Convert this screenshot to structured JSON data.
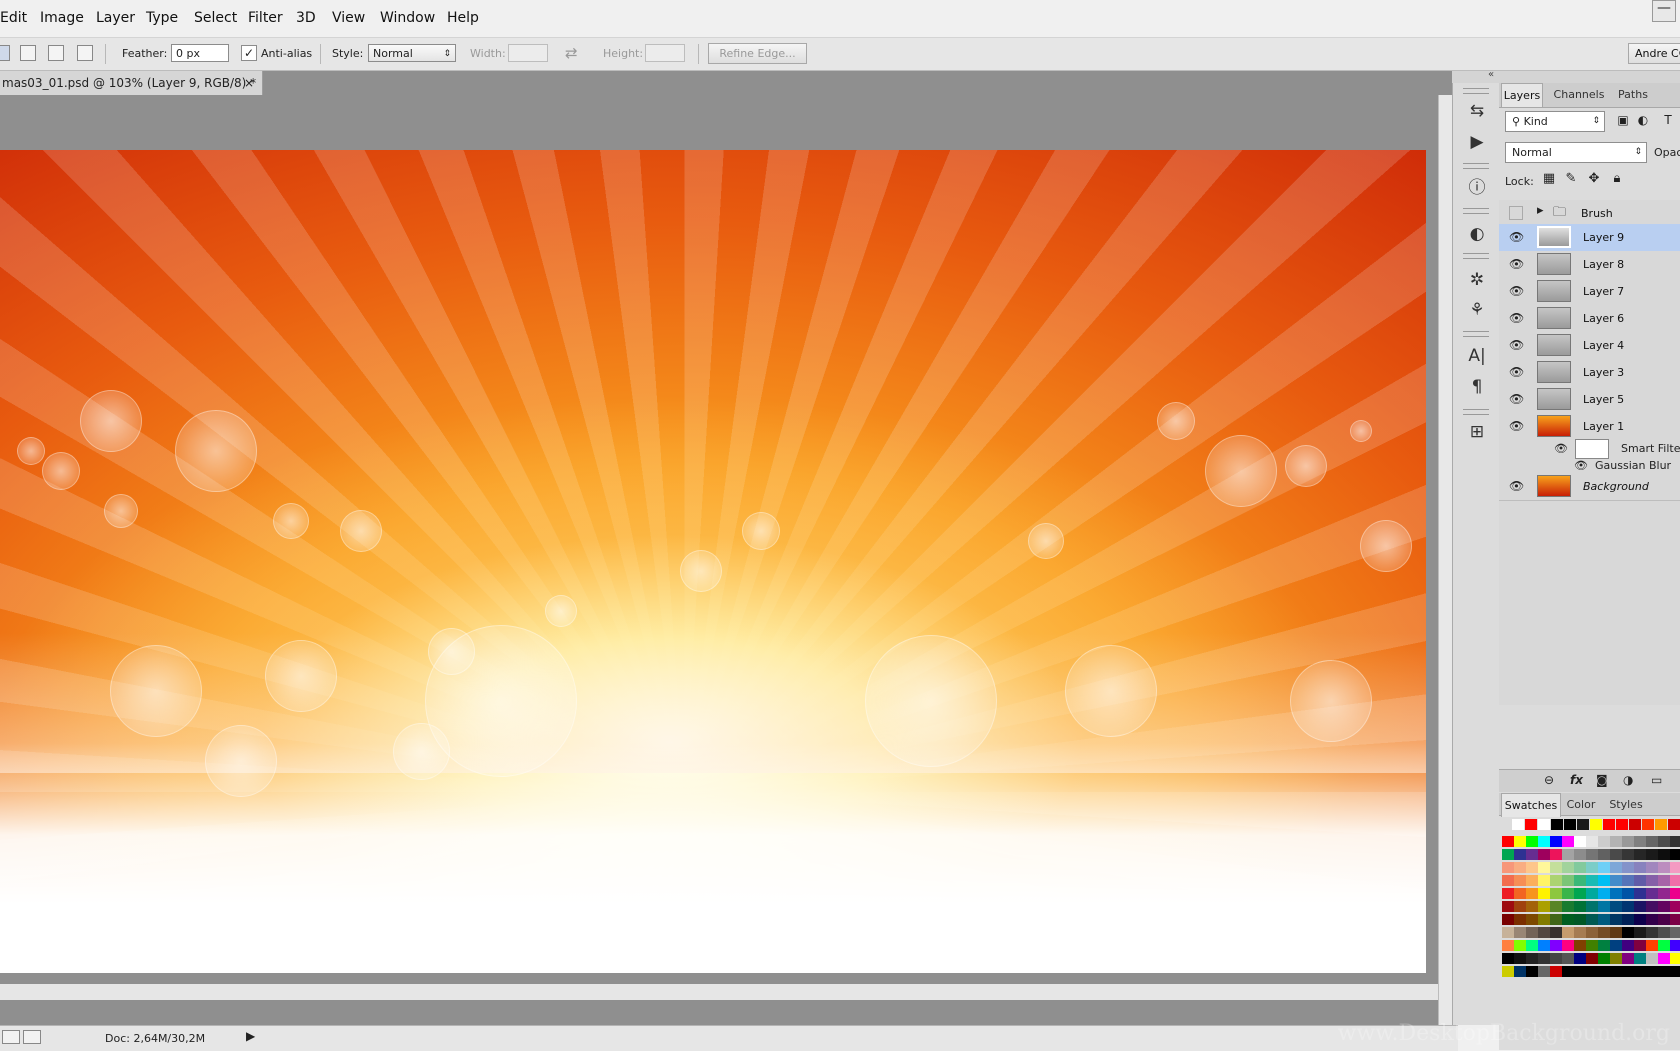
{
  "menu": [
    "Edit",
    "Image",
    "Layer",
    "Type",
    "Select",
    "Filter",
    "3D",
    "View",
    "Window",
    "Help"
  ],
  "window": {
    "minimize": "—"
  },
  "options": {
    "feather_label": "Feather:",
    "feather_value": "0 px",
    "antialias_label": "Anti-alias",
    "antialias_check": "✓",
    "style_label": "Style:",
    "style_value": "Normal",
    "width_label": "Width:",
    "height_label": "Height:",
    "swap_icon": "⇄",
    "refine_edge": "Refine Edge...",
    "user_button": "Andre CC"
  },
  "document": {
    "tab_title": "mas03_01.psd @ 103% (Layer 9, RGB/8) *",
    "close": "×"
  },
  "status": {
    "doc_size": "Doc: 2,64M/30,2M",
    "arrow": "▶"
  },
  "panel_collapse": "«",
  "tools": {
    "history": "⇆",
    "actions": "▶",
    "info": "ⓘ",
    "adjustments": "◐",
    "navigator": "✲",
    "brush": "⚘",
    "character": "A|",
    "paragraph": "¶",
    "tool_presets": "⊞"
  },
  "layers_panel": {
    "tabs": [
      "Layers",
      "Channels",
      "Paths"
    ],
    "kind": "Kind",
    "blend_mode": "Normal",
    "opacity_label": "Opac",
    "lock_label": "Lock:",
    "layers": [
      {
        "name": "Brush",
        "type": "group",
        "visible": false,
        "selected": false
      },
      {
        "name": "Layer 9",
        "visible": true,
        "selected": true
      },
      {
        "name": "Layer 8",
        "visible": true,
        "selected": false
      },
      {
        "name": "Layer 7",
        "visible": true,
        "selected": false
      },
      {
        "name": "Layer 6",
        "visible": true,
        "selected": false
      },
      {
        "name": "Layer 4",
        "visible": true,
        "selected": false
      },
      {
        "name": "Layer 3",
        "visible": true,
        "selected": false
      },
      {
        "name": "Layer 5",
        "visible": true,
        "selected": false
      },
      {
        "name": "Layer 1",
        "visible": true,
        "selected": false
      },
      {
        "name": "Background",
        "visible": true,
        "selected": false,
        "italic": true
      }
    ],
    "smart_filters": "Smart Filters",
    "gaussian_blur": "Gaussian Blur",
    "bottom_icons": {
      "link": "⊖",
      "fx": "fx",
      "mask": "◙",
      "adjust": "◑",
      "folder": "▭"
    }
  },
  "swatches_panel": {
    "tabs": [
      "Swatches",
      "Color",
      "Styles"
    ],
    "top_row": [
      "#ffffff",
      "#ff0000",
      "#ffffff",
      "#000000",
      "#000000",
      "#1a1a1a",
      "#ffff00",
      "#ff0000",
      "#ff0000",
      "#cc0000",
      "#ff3300",
      "#ff9900",
      "#cc0000"
    ],
    "rows": [
      [
        "#ff0000",
        "#ffff00",
        "#00ff00",
        "#00ffff",
        "#0000ff",
        "#ff00ff",
        "#ffffff",
        "#e6e6e6",
        "#cccccc",
        "#b3b3b3",
        "#999999",
        "#808080",
        "#666666",
        "#4d4d4d",
        "#333333"
      ],
      [
        "#00a651",
        "#2e3192",
        "#662d91",
        "#9e005d",
        "#ed145b",
        "#a3a3a3",
        "#8c8c8c",
        "#757575",
        "#616161",
        "#4a4a4a",
        "#363636",
        "#262626",
        "#1a1a1a",
        "#0d0d0d",
        "#000000"
      ],
      [
        "#f7977a",
        "#f9ad81",
        "#fdc68a",
        "#fff79a",
        "#c4df9b",
        "#a2d39c",
        "#82ca9d",
        "#7bcdc8",
        "#6ecff6",
        "#7ea7d8",
        "#8493ca",
        "#8882be",
        "#a187be",
        "#bc8dbf",
        "#f49ac2"
      ],
      [
        "#f26c4f",
        "#f68e55",
        "#fbaf5c",
        "#fff467",
        "#acd372",
        "#7cc576",
        "#3bb878",
        "#1abbb4",
        "#00bff3",
        "#438cca",
        "#5574b9",
        "#605ca8",
        "#855fa8",
        "#a763a8",
        "#f06ea9"
      ],
      [
        "#ed1c24",
        "#f26522",
        "#f7941d",
        "#fff200",
        "#8dc73f",
        "#39b54a",
        "#00a651",
        "#00a99d",
        "#00aeef",
        "#0072bc",
        "#0054a6",
        "#2e3192",
        "#662d91",
        "#92278f",
        "#ec008c"
      ],
      [
        "#9e0b0f",
        "#a0410d",
        "#a36209",
        "#aba000",
        "#598527",
        "#197b30",
        "#007236",
        "#00746b",
        "#0076a3",
        "#004b80",
        "#003471",
        "#1b1464",
        "#440e62",
        "#630460",
        "#9e005d"
      ],
      [
        "#790000",
        "#7b2e00",
        "#7d4900",
        "#827b00",
        "#406618",
        "#005e20",
        "#005826",
        "#005952",
        "#005b7f",
        "#003663",
        "#002157",
        "#0d004c",
        "#32004b",
        "#4b0049",
        "#7b0046"
      ],
      [
        "#c7b299",
        "#998675",
        "#736357",
        "#534741",
        "#37302d",
        "#c69c6d",
        "#a67c52",
        "#8c6239",
        "#754c24",
        "#603913",
        "#000000",
        "#1a1a1a",
        "#333333",
        "#4d4d4d",
        "#666666"
      ],
      [
        "#ff8040",
        "#80ff00",
        "#00ff80",
        "#0080ff",
        "#8000ff",
        "#ff0080",
        "#804000",
        "#408000",
        "#008040",
        "#004080",
        "#400080",
        "#800040",
        "#ff4000",
        "#00ff40",
        "#4000ff"
      ],
      [
        "#000000",
        "#111111",
        "#222222",
        "#333333",
        "#444444",
        "#555555",
        "#000080",
        "#800000",
        "#008000",
        "#808000",
        "#800080",
        "#008080",
        "#c0c0c0",
        "#ff00ff",
        "#ffff00"
      ],
      [
        "#cccc00",
        "#003366",
        "#000000",
        "#666666",
        "#cc0000",
        "#000000",
        "#000000",
        "#000000",
        "#000000",
        "#000000",
        "#000000",
        "#000000",
        "#000000",
        "#000000",
        "#000000"
      ]
    ]
  },
  "watermark": "www.DesktopBackground.org",
  "colors": {
    "selected_row": "#b9cff1",
    "canvas_red": "#c71c06",
    "canvas_orange": "#f99a1e"
  }
}
